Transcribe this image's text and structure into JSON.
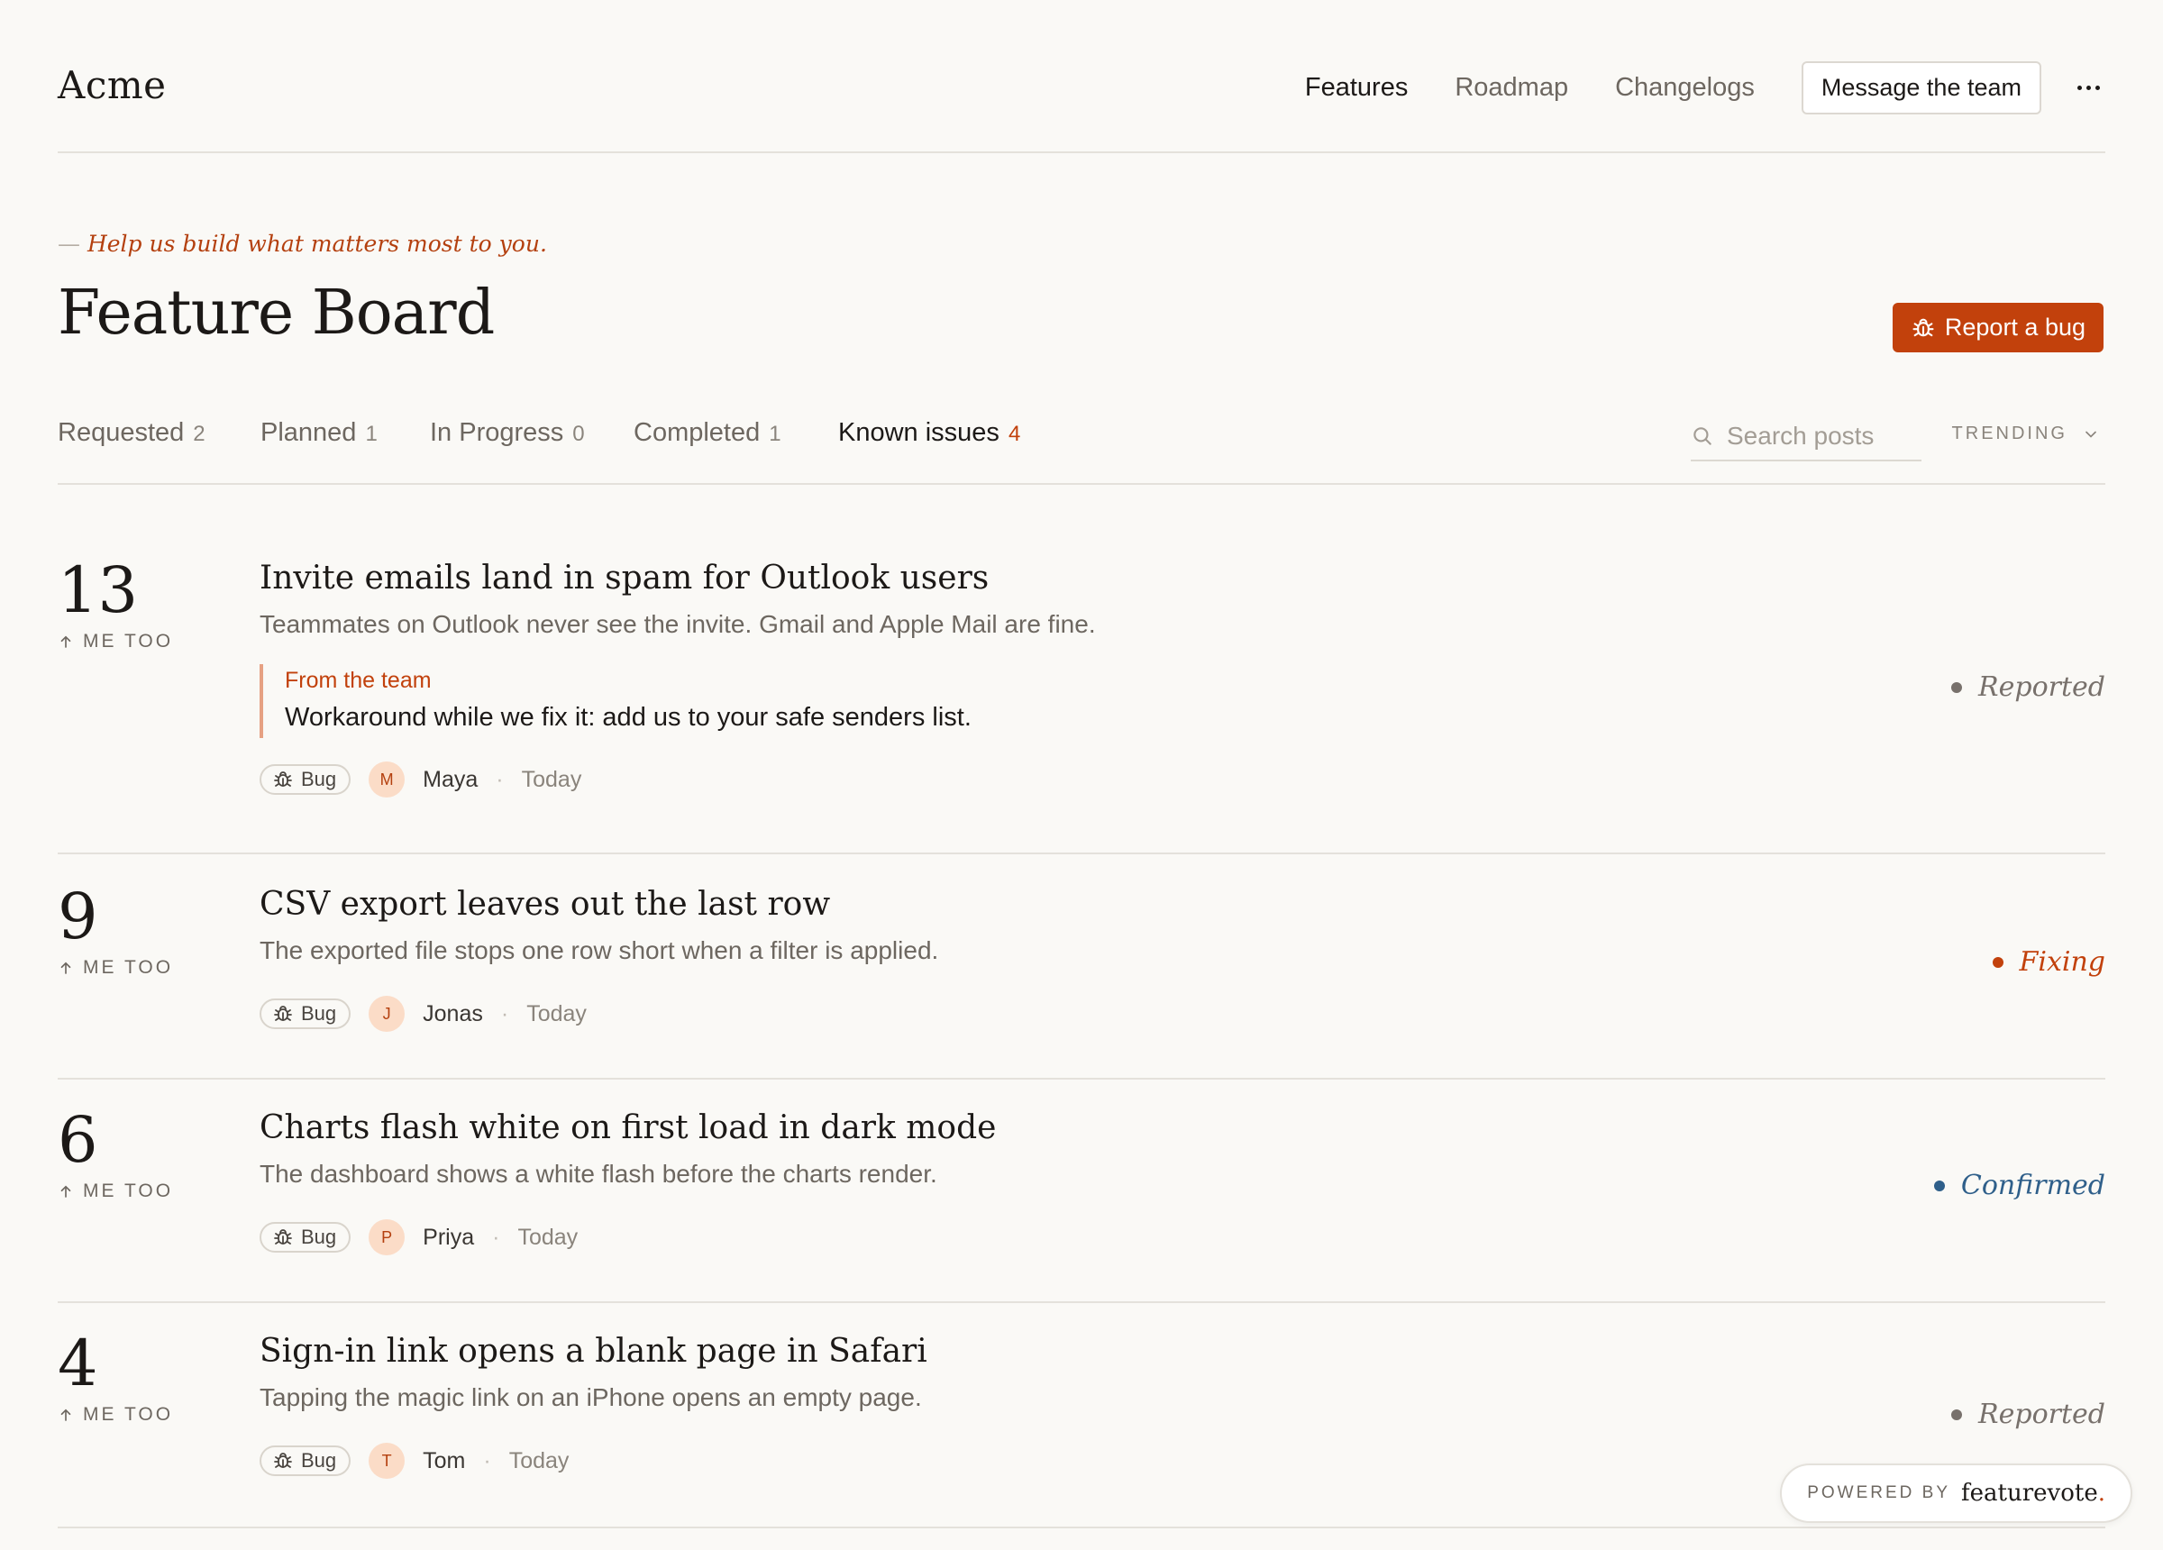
{
  "header": {
    "brand": "Acme",
    "nav": [
      "Features",
      "Roadmap",
      "Changelogs"
    ],
    "message_button": "Message the team"
  },
  "hero": {
    "tagline_dash": "—",
    "tagline": "Help us build what matters most to you.",
    "title": "Feature Board",
    "report_button": "Report a bug"
  },
  "tabs": [
    {
      "label": "Requested",
      "count": "2"
    },
    {
      "label": "Planned",
      "count": "1"
    },
    {
      "label": "In Progress",
      "count": "0"
    },
    {
      "label": "Completed",
      "count": "1"
    },
    {
      "label": "Known issues",
      "count": "4"
    }
  ],
  "active_tab": "Known issues",
  "search": {
    "placeholder": "Search posts"
  },
  "sort": {
    "label": "TRENDING"
  },
  "me_too_label": "ME TOO",
  "posts": [
    {
      "votes": "13",
      "title": "Invite emails land in spam for Outlook users",
      "description": "Teammates on Outlook never see the invite. Gmail and Apple Mail are fine.",
      "team_note": {
        "label": "From the team",
        "text": "Workaround while we fix it: add us to your safe senders list."
      },
      "tag": "Bug",
      "author_initial": "M",
      "author": "Maya",
      "separator": "·",
      "when": "Today",
      "status": "Reported",
      "status_color": "#78716c"
    },
    {
      "votes": "9",
      "title": "CSV export leaves out the last row",
      "description": "The exported file stops one row short when a filter is applied.",
      "tag": "Bug",
      "author_initial": "J",
      "author": "Jonas",
      "separator": "·",
      "when": "Today",
      "status": "Fixing",
      "status_color": "#c2410c"
    },
    {
      "votes": "6",
      "title": "Charts flash white on first load in dark mode",
      "description": "The dashboard shows a white flash before the charts render.",
      "tag": "Bug",
      "author_initial": "P",
      "author": "Priya",
      "separator": "·",
      "when": "Today",
      "status": "Confirmed",
      "status_color": "#2f5f8a"
    },
    {
      "votes": "4",
      "title": "Sign-in link opens a blank page in Safari",
      "description": "Tapping the magic link on an iPhone opens an empty page.",
      "tag": "Bug",
      "author_initial": "T",
      "author": "Tom",
      "separator": "·",
      "when": "Today",
      "status": "Reported",
      "status_color": "#78716c"
    }
  ],
  "powered": {
    "label": "POWERED BY",
    "brand": "featurevote",
    "dot": "."
  }
}
